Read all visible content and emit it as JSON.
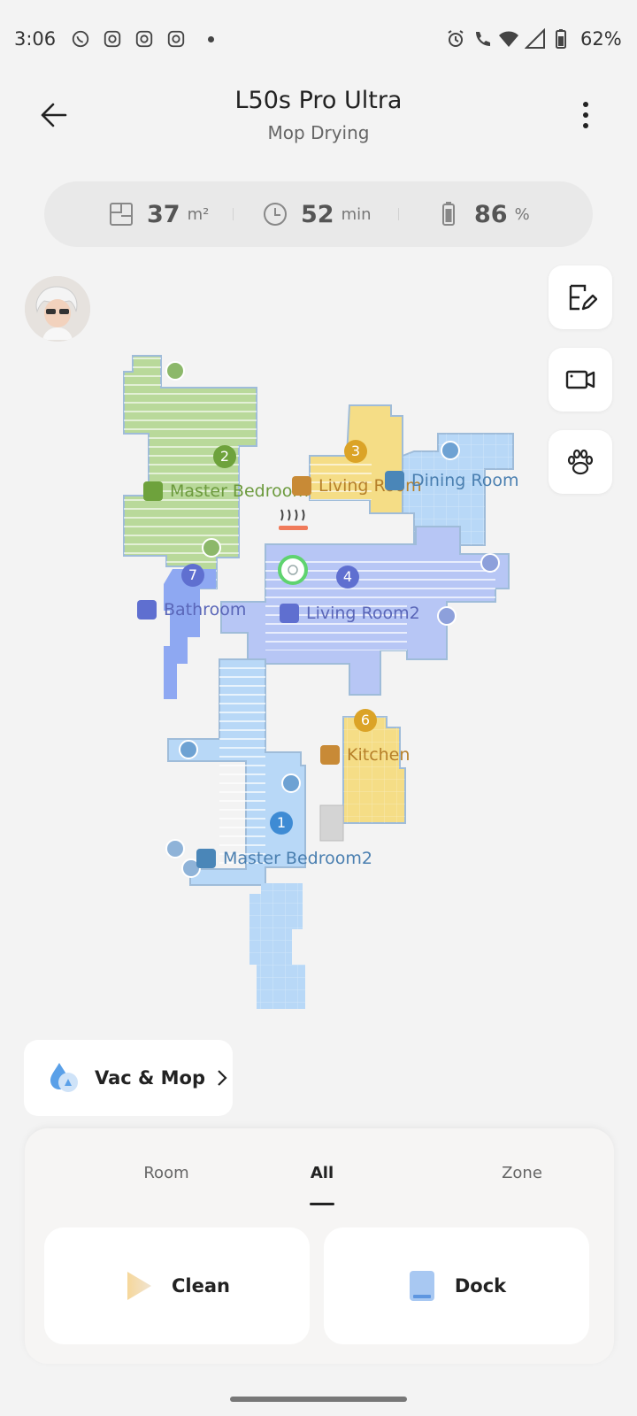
{
  "status_bar": {
    "time": "3:06",
    "battery": "62%",
    "left_icons": [
      "whatsapp-icon",
      "instagram-icon",
      "instagram-icon",
      "instagram-icon"
    ],
    "right_icons": [
      "alarm-icon",
      "wifi-call-icon",
      "wifi-icon",
      "signal-icon",
      "battery-icon"
    ]
  },
  "header": {
    "title": "L50s Pro Ultra",
    "subtitle": "Mop Drying"
  },
  "stats": {
    "area_value": "37",
    "area_unit": "m²",
    "time_value": "52",
    "time_unit": "min",
    "battery_value": "86",
    "battery_unit": "%"
  },
  "side_buttons": [
    "edit-map-icon",
    "camera-icon",
    "pet-paw-icon"
  ],
  "map": {
    "rooms": [
      {
        "number": "2",
        "name": "Master Bedroom",
        "color": "#7aa64a"
      },
      {
        "number": "3",
        "name": "Living Room",
        "color": "#c48a2a"
      },
      {
        "number": "",
        "name": "Dining Room",
        "color": "#4a86b8"
      },
      {
        "number": "7",
        "name": "Bathroom",
        "color": "#6470c4"
      },
      {
        "number": "4",
        "name": "Living Room2",
        "color": "#6470c4"
      },
      {
        "number": "6",
        "name": "Kitchen",
        "color": "#c48a2a"
      },
      {
        "number": "1",
        "name": "Master Bedroom2",
        "color": "#4a86b8"
      }
    ]
  },
  "mode": {
    "label": "Vac & Mop"
  },
  "tabs": [
    {
      "label": "Room"
    },
    {
      "label": "All"
    },
    {
      "label": "Zone"
    }
  ],
  "actions": {
    "clean_label": "Clean",
    "dock_label": "Dock"
  },
  "colors": {
    "green_room": "#b9d99a",
    "yellow_room": "#f5dd86",
    "blue_room": "#b8d8f7",
    "purple_room": "#b7c6f5",
    "bathroom": "#8ea8f2"
  }
}
